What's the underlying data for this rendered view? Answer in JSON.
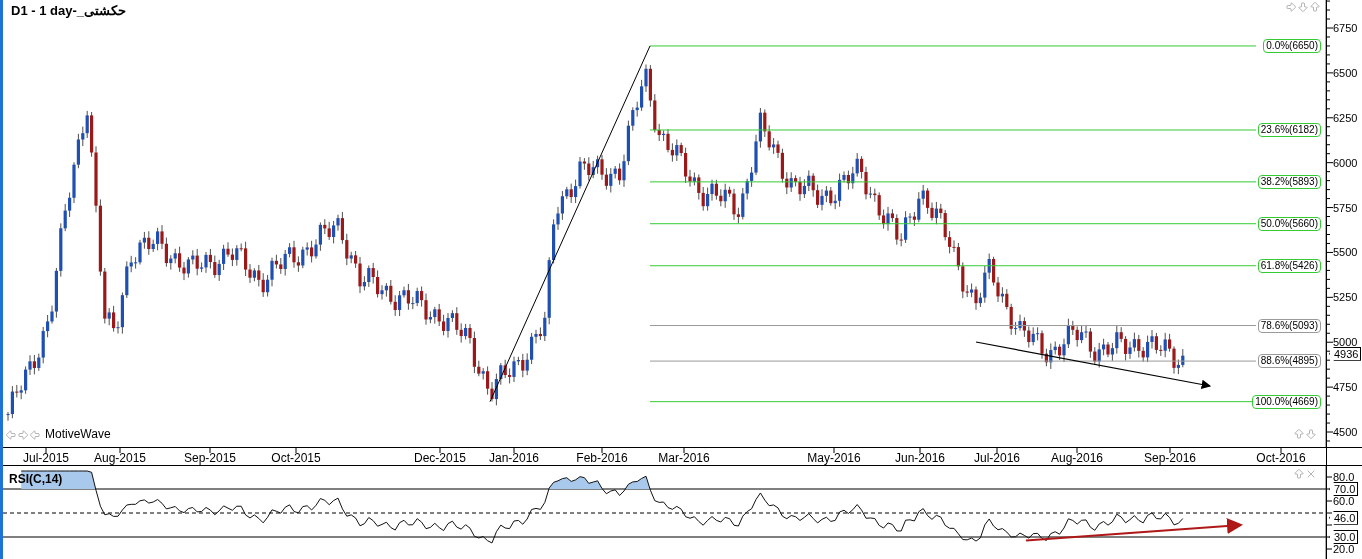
{
  "chart_title": "D1 - 1 day-_حکشتی",
  "brand_label": "MotiveWave",
  "price_axis": {
    "ticks": [
      "6750",
      "6500",
      "6250",
      "6000",
      "5750",
      "5500",
      "5250",
      "5000",
      "4750",
      "4500"
    ],
    "current_price": "4936"
  },
  "fib_levels": [
    {
      "label": "0.0%(6650)",
      "color": "#33cc33"
    },
    {
      "label": "23.6%(6182)",
      "color": "#33cc33"
    },
    {
      "label": "38.2%(5893)",
      "color": "#33cc33"
    },
    {
      "label": "50.0%(5660)",
      "color": "#33cc33"
    },
    {
      "label": "61.8%(5426)",
      "color": "#33cc33"
    },
    {
      "label": "78.6%(5093)",
      "color": "#9a9a9a"
    },
    {
      "label": "88.6%(4895)",
      "color": "#9a9a9a"
    },
    {
      "label": "100.0%(4669)",
      "color": "#33cc33"
    }
  ],
  "date_axis": [
    "Jul-2015",
    "Aug-2015",
    "Sep-2015",
    "Oct-2015",
    "Dec-2015",
    "Jan-2016",
    "Feb-2016",
    "Mar-2016",
    "May-2016",
    "Jun-2016",
    "Jul-2016",
    "Aug-2016",
    "Sep-2016",
    "Oct-2016"
  ],
  "rsi": {
    "title": "RSI(C,14)",
    "ticks": [
      "80.0",
      "60.0",
      "20.0"
    ],
    "tags": [
      "70.0",
      "46.0",
      "30.0"
    ]
  }
}
